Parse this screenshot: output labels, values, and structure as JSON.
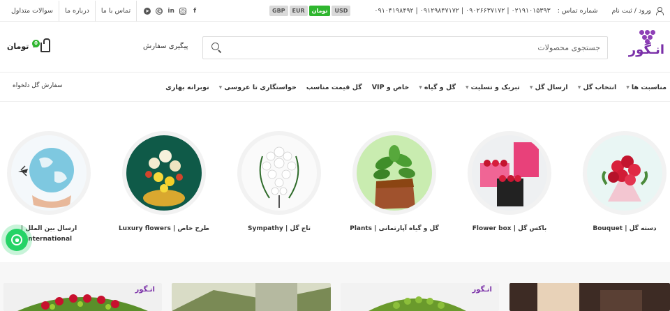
{
  "topbar": {
    "links": [
      "سوالات متداول",
      "درباره ما",
      "تماس با ما"
    ],
    "social": [
      {
        "icon": "telegram-icon",
        "glyph": "➤"
      },
      {
        "icon": "whatsapp-icon",
        "glyph": "©"
      },
      {
        "icon": "linkedin-icon",
        "glyph": "in"
      },
      {
        "icon": "instagram-icon",
        "glyph": "◎"
      },
      {
        "icon": "facebook-icon",
        "glyph": "f"
      }
    ],
    "currencies": [
      "GBP",
      "EUR",
      "تومان",
      "USD"
    ],
    "active_currency": "تومان",
    "phones": "۰۲۱۹۱۰۱۵۳۹۳ | ۰۹۰۲۶۶۳۷۱۷۲ | ۰۹۱۲۹۸۴۷۱۷۲ | ۰۹۱۰۴۱۹۸۴۹۲",
    "phone_label": "شماره تماس :",
    "login": "ورود / ثبت نام"
  },
  "header": {
    "logo_text": "انـگور",
    "search_placeholder": "جستجوی محصولات",
    "track_order": "پیگیری سفارش",
    "cart_total": "۰ تومان",
    "cart_count": "0"
  },
  "nav": {
    "items": [
      {
        "label": "مناسبت ها",
        "dropdown": true
      },
      {
        "label": "انتخاب گل",
        "dropdown": true
      },
      {
        "label": "ارسال گل",
        "dropdown": true
      },
      {
        "label": "تبریک و تسلیت",
        "dropdown": true
      },
      {
        "label": "گل و گیاه",
        "dropdown": true
      },
      {
        "label": "خاص و VIP",
        "dropdown": false
      },
      {
        "label": "گل قیمت مناسب",
        "dropdown": false
      },
      {
        "label": "خواستگاری تا عروسی",
        "dropdown": true
      },
      {
        "label": "نوبرانه بهاری",
        "dropdown": false
      }
    ],
    "custom_order": "سفارش گل دلخواه"
  },
  "categories": [
    {
      "label": "دسته گل | Bouquet",
      "label2": "",
      "theme": "bouquet"
    },
    {
      "label": "باکس گل | Flower box",
      "label2": "",
      "theme": "box"
    },
    {
      "label": "گل و گیاه آپارتمانی | Plants",
      "label2": "",
      "theme": "plant"
    },
    {
      "label": "تاج گل | Sympathy",
      "label2": "",
      "theme": "wreath"
    },
    {
      "label": "طرح خاص | Luxury flowers",
      "label2": "",
      "theme": "luxury"
    },
    {
      "label": "ارسال بین الملل |",
      "label2": "International",
      "theme": "globe"
    }
  ],
  "products": {
    "logo_text": "انـگور"
  },
  "colors": {
    "accent": "#2fb62f",
    "brand": "#7a2fa8",
    "whatsapp": "#25d366"
  }
}
